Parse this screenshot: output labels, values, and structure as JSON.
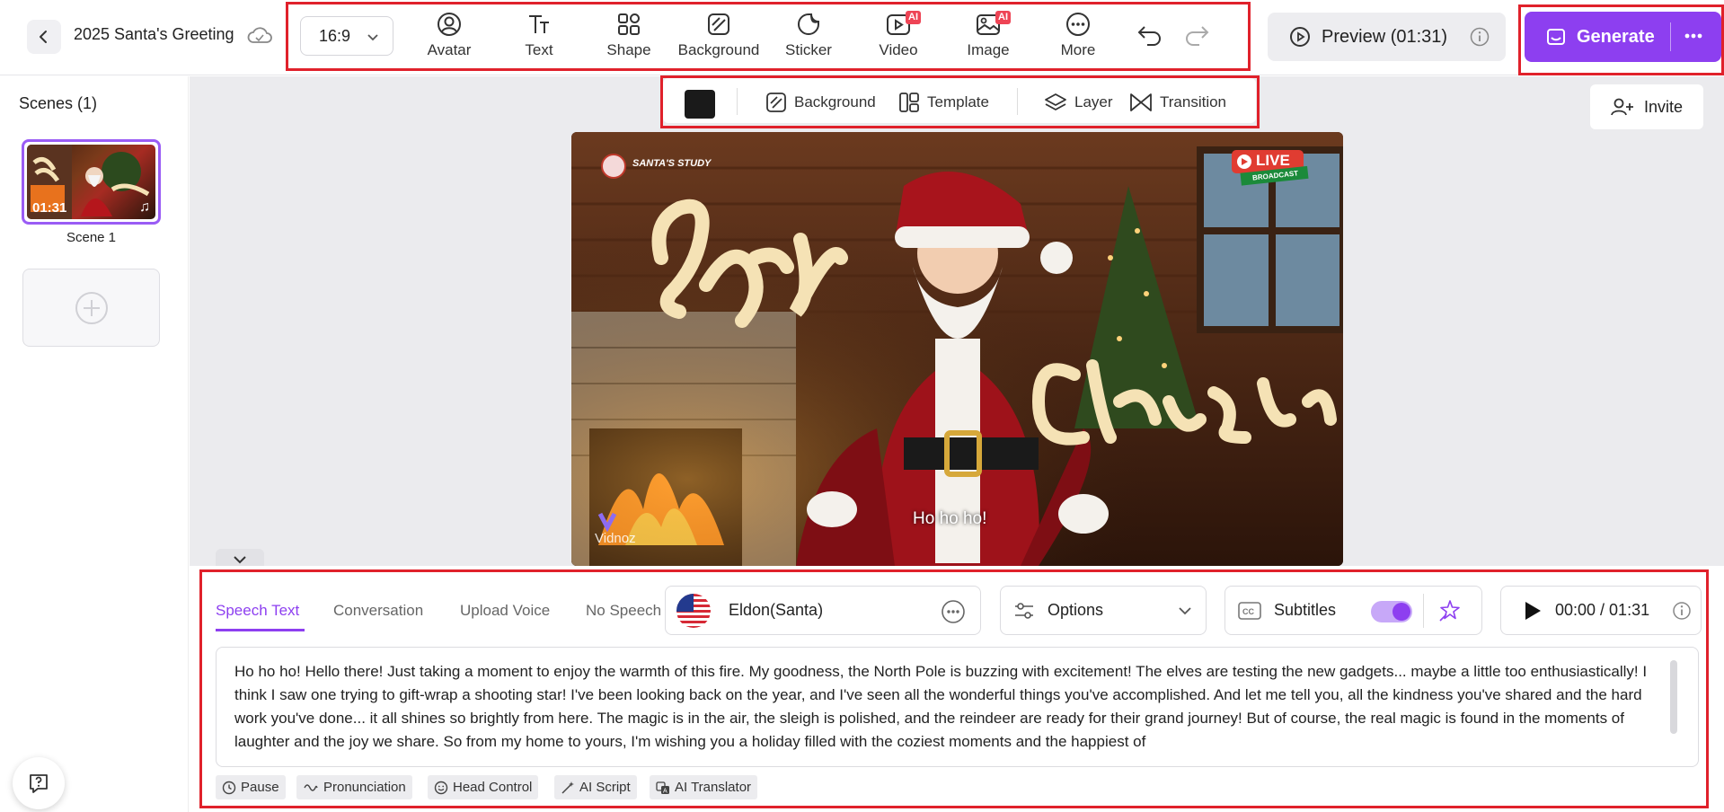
{
  "header": {
    "project_title": "2025 Santa's Greeting",
    "aspect_ratio": "16:9",
    "tools": [
      {
        "label": "Avatar",
        "icon": "avatar-icon",
        "ai": false
      },
      {
        "label": "Text",
        "icon": "text-icon",
        "ai": false
      },
      {
        "label": "Shape",
        "icon": "shape-icon",
        "ai": false
      },
      {
        "label": "Background",
        "icon": "background-icon",
        "ai": false
      },
      {
        "label": "Sticker",
        "icon": "sticker-icon",
        "ai": false
      },
      {
        "label": "Video",
        "icon": "video-icon",
        "ai": true
      },
      {
        "label": "Image",
        "icon": "image-icon",
        "ai": true
      },
      {
        "label": "More",
        "icon": "more-icon",
        "ai": false
      }
    ],
    "ai_badge": "AI",
    "preview_label": "Preview (01:31)",
    "generate_label": "Generate",
    "accent_color": "#8d3ff0",
    "highlight_color": "#e0212b"
  },
  "sidebar": {
    "title": "Scenes (1)",
    "scenes": [
      {
        "label": "Scene 1",
        "duration": "01:31"
      }
    ]
  },
  "canvas_toolbar": {
    "swatch_color": "#1a1a1a",
    "items": [
      "Background",
      "Template",
      "Layer",
      "Transition"
    ]
  },
  "invite_label": "Invite",
  "stage": {
    "channel_label": "SANTA'S STUDY",
    "live_label": "LIVE",
    "broadcast_label": "BROADCAST",
    "merry_text": "Merry",
    "christmas_text": "Christmas",
    "subtitle": "Ho ho ho!",
    "watermark": "Vidnoz"
  },
  "speech_panel": {
    "tabs": [
      "Speech Text",
      "Conversation",
      "Upload Voice",
      "No Speech"
    ],
    "active_tab": "Speech Text",
    "voice_name": "Eldon(Santa)",
    "options_label": "Options",
    "subtitles_label": "Subtitles",
    "subtitles_on": true,
    "playback_time": "00:00 / 01:31",
    "speech_text": "Ho ho ho! Hello there! Just taking a moment to enjoy the warmth of this fire. My goodness, the North Pole is buzzing with excitement! The elves are testing the new gadgets... maybe a little too enthusiastically! I think I saw one trying to gift-wrap a shooting star! I've been looking back on the year, and I've seen all the wonderful things you've accomplished. And let me tell you, all the kindness you've shared and the hard work you've done... it all shines so brightly from here. The magic is in the air, the sleigh is polished, and the reindeer are ready for their grand journey! But of course, the real magic is found in the moments of laughter and the joy we share. So from my home to yours, I'm wishing you a holiday filled with the coziest moments and the happiest of",
    "chips": [
      "Pause",
      "Pronunciation",
      "Head Control",
      "AI Script",
      "AI Translator"
    ]
  }
}
